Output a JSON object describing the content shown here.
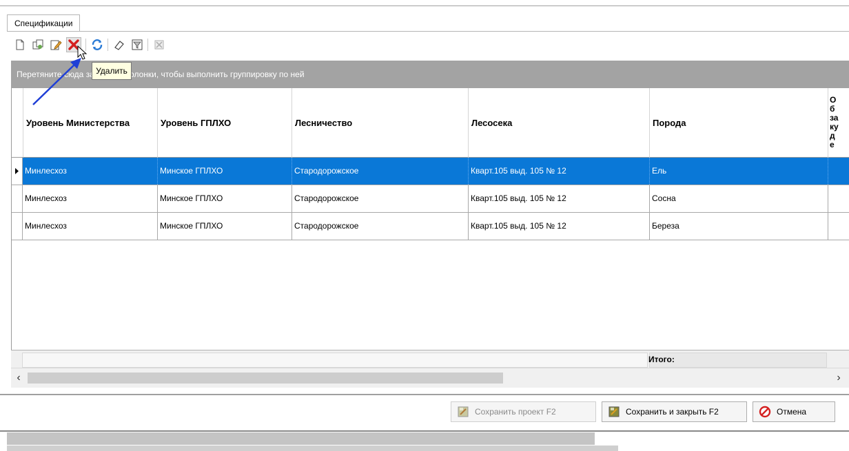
{
  "tab": {
    "label": "Спецификации"
  },
  "toolbar": {
    "buttons": [
      "new-document-icon",
      "copy-icon",
      "edit-icon",
      "delete-icon",
      "refresh-icon",
      "eraser-icon",
      "filter-icon",
      "export-icon"
    ]
  },
  "tooltip": {
    "text": "Удалить"
  },
  "group_panel": {
    "hint": "Перетяните сюда заголовок колонки, чтобы выполнить группировку по ней"
  },
  "grid": {
    "columns": [
      "Уровень Министерства",
      "Уровень ГПЛХО",
      "Лесничество",
      "Лесосека",
      "Порода",
      "Об за ку де"
    ],
    "rows": [
      [
        "Минлесхоз",
        "Минское ГПЛХО",
        "Стародорожское",
        "Кварт.105 выд. 105 № 12",
        "Ель"
      ],
      [
        "Минлесхоз",
        "Минское ГПЛХО",
        "Стародорожское",
        "Кварт.105 выд. 105 № 12",
        "Сосна"
      ],
      [
        "Минлесхоз",
        "Минское ГПЛХО",
        "Стародорожское",
        "Кварт.105 выд. 105 № 12",
        "Береза"
      ]
    ],
    "selected_row": 0,
    "totals_label": "Итого:"
  },
  "buttons": {
    "save_project": "Сохранить проект F2",
    "save_close": "Сохранить и закрыть F2",
    "cancel": "Отмена"
  },
  "colors": {
    "selection": "#0a78d7",
    "group_panel": "#a3a3a3",
    "tooltip_bg": "#ffffe1"
  }
}
